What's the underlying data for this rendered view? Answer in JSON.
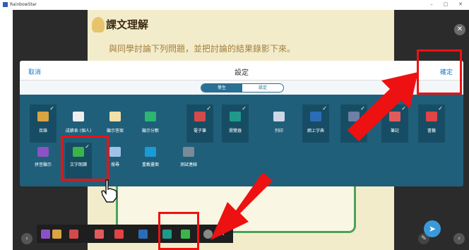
{
  "window": {
    "title": "RainbowStar",
    "controls": [
      "–",
      "▢",
      "✕"
    ]
  },
  "lesson": {
    "title": "課文理解",
    "subtitle": "與同學討論下列問題，並把討論的結果錄影下來。"
  },
  "dialog": {
    "title": "設定",
    "cancel_label": "取消",
    "confirm_label": "確定",
    "tabs": [
      {
        "label": "學生",
        "active": true
      },
      {
        "label": "設定",
        "active": false
      }
    ],
    "tools_row1": [
      {
        "label": "目錄",
        "icon": "list-icon",
        "color": "#d9a441",
        "enabled": true
      },
      {
        "label": "成績表 (個人)",
        "icon": "scorecard-icon",
        "color": "#eeeeee",
        "enabled": false
      },
      {
        "label": "顯示答案",
        "icon": "answer-icon",
        "color": "#f1e0a8",
        "enabled": false
      },
      {
        "label": "顯示分數",
        "icon": "score-icon",
        "color": "#2bb673",
        "enabled": false
      },
      {
        "label": "電子筆",
        "icon": "pen-icon",
        "color": "#d24a4a",
        "enabled": true
      },
      {
        "label": "瀏覽器",
        "icon": "globe-icon",
        "color": "#1f9a8a",
        "enabled": true
      },
      {
        "label": "列印",
        "icon": "printer-icon",
        "color": "#cdd7e6",
        "enabled": false
      },
      {
        "label": "網上字典",
        "icon": "dictionary-icon",
        "color": "#2b6cb8",
        "enabled": true
      },
      {
        "label": "字典",
        "icon": "book-icon",
        "color": "#6e7fa8",
        "enabled": true
      },
      {
        "label": "筆記",
        "icon": "note-icon",
        "color": "#e15b5b",
        "enabled": true
      },
      {
        "label": "書籤",
        "icon": "bookmark-icon",
        "color": "#e04444",
        "enabled": true
      }
    ],
    "tools_row2": [
      {
        "label": "拼音顯示",
        "icon": "pinyin-icon",
        "color": "#8a52c6",
        "enabled": false
      },
      {
        "label": "文字朗讀",
        "icon": "tts-icon",
        "color": "#3bb54a",
        "enabled": true
      },
      {
        "label": "搜尋",
        "icon": "search-icon",
        "color": "#9fc3e8",
        "enabled": false
      },
      {
        "label": "重載畫面",
        "icon": "reload-icon",
        "color": "#1b9bd6",
        "enabled": false
      },
      {
        "label": "測試連線",
        "icon": "signal-icon",
        "color": "#7a8a97",
        "enabled": false
      }
    ]
  },
  "toolbar": {
    "items": [
      "pinyin-icon",
      "list-icon",
      "pen-icon",
      "note-icon",
      "bookmark-icon",
      "dictionary-icon",
      "globe-icon",
      "tts-icon",
      "settings-icon",
      "close-icon"
    ]
  },
  "colors": {
    "accent": "#1f5f7a",
    "annotation": "#ee1111",
    "link": "#1b78c5"
  }
}
